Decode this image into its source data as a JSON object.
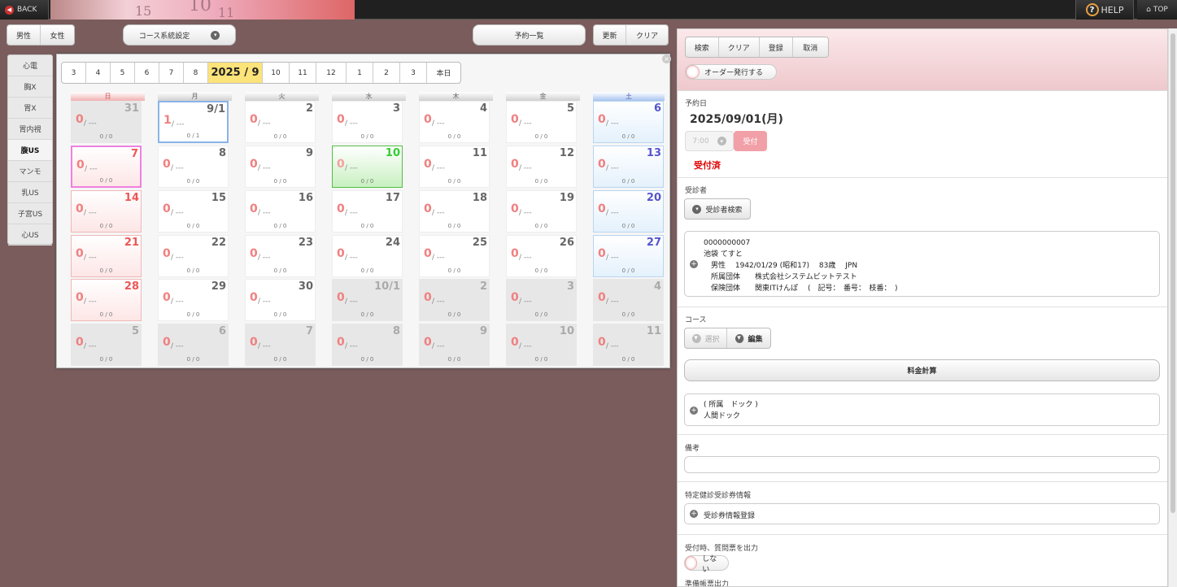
{
  "topbar": {
    "back_label": "BACK",
    "help_label": "HELP",
    "top_label": "TOP",
    "banner_numbers": [
      "15",
      "10",
      "11"
    ]
  },
  "toolbar": {
    "gender": [
      "男性",
      "女性"
    ],
    "course_system": "コース系統設定",
    "reservation_list": "予約一覧",
    "update": "更新",
    "clear": "クリア"
  },
  "sidebar": {
    "items": [
      "心電",
      "胸X",
      "胃X",
      "胃内視",
      "腹US",
      "マンモ",
      "乳US",
      "子宮US",
      "心US"
    ],
    "active_index": 4
  },
  "calendar": {
    "months": [
      "3",
      "4",
      "5",
      "6",
      "7",
      "8"
    ],
    "current": "2025 / 9",
    "months_after": [
      "10",
      "11",
      "12",
      "1",
      "2",
      "3"
    ],
    "today_btn": "本日",
    "close": "×",
    "weekdays": [
      "日",
      "月",
      "火",
      "水",
      "木",
      "金",
      "土"
    ],
    "zero": "0",
    "dash": "/ ---",
    "weeks": [
      [
        {
          "d": "31",
          "t": "prev",
          "c": "0 / 0",
          "n": "0"
        },
        {
          "d": "9/1",
          "t": "sel",
          "c": "0 / 1",
          "n": "1"
        },
        {
          "d": "2",
          "t": "",
          "c": "0 / 0",
          "n": "0"
        },
        {
          "d": "3",
          "t": "",
          "c": "0 / 0",
          "n": "0"
        },
        {
          "d": "4",
          "t": "",
          "c": "0 / 0",
          "n": "0"
        },
        {
          "d": "5",
          "t": "",
          "c": "0 / 0",
          "n": "0"
        },
        {
          "d": "6",
          "t": "sat",
          "c": "0 / 0",
          "n": "0"
        }
      ],
      [
        {
          "d": "7",
          "t": "sun hl",
          "c": "0 / 0",
          "n": "0"
        },
        {
          "d": "8",
          "t": "",
          "c": "0 / 0",
          "n": "0"
        },
        {
          "d": "9",
          "t": "",
          "c": "0 / 0",
          "n": "0"
        },
        {
          "d": "10",
          "t": "today",
          "c": "0 / 0",
          "n": "0"
        },
        {
          "d": "11",
          "t": "",
          "c": "0 / 0",
          "n": "0"
        },
        {
          "d": "12",
          "t": "",
          "c": "0 / 0",
          "n": "0"
        },
        {
          "d": "13",
          "t": "sat",
          "c": "0 / 0",
          "n": "0"
        }
      ],
      [
        {
          "d": "14",
          "t": "sun",
          "c": "0 / 0",
          "n": "0"
        },
        {
          "d": "15",
          "t": "",
          "c": "0 / 0",
          "n": "0"
        },
        {
          "d": "16",
          "t": "",
          "c": "0 / 0",
          "n": "0"
        },
        {
          "d": "17",
          "t": "",
          "c": "0 / 0",
          "n": "0"
        },
        {
          "d": "18",
          "t": "",
          "c": "0 / 0",
          "n": "0"
        },
        {
          "d": "19",
          "t": "",
          "c": "0 / 0",
          "n": "0"
        },
        {
          "d": "20",
          "t": "sat",
          "c": "0 / 0",
          "n": "0"
        }
      ],
      [
        {
          "d": "21",
          "t": "sun",
          "c": "0 / 0",
          "n": "0"
        },
        {
          "d": "22",
          "t": "",
          "c": "0 / 0",
          "n": "0"
        },
        {
          "d": "23",
          "t": "",
          "c": "0 / 0",
          "n": "0"
        },
        {
          "d": "24",
          "t": "",
          "c": "0 / 0",
          "n": "0"
        },
        {
          "d": "25",
          "t": "",
          "c": "0 / 0",
          "n": "0"
        },
        {
          "d": "26",
          "t": "",
          "c": "0 / 0",
          "n": "0"
        },
        {
          "d": "27",
          "t": "sat",
          "c": "0 / 0",
          "n": "0"
        }
      ],
      [
        {
          "d": "28",
          "t": "sun",
          "c": "0 / 0",
          "n": "0"
        },
        {
          "d": "29",
          "t": "",
          "c": "0 / 0",
          "n": "0"
        },
        {
          "d": "30",
          "t": "",
          "c": "0 / 0",
          "n": "0"
        },
        {
          "d": "10/1",
          "t": "prev",
          "c": "0 / 0",
          "n": "0"
        },
        {
          "d": "2",
          "t": "prev",
          "c": "0 / 0",
          "n": "0"
        },
        {
          "d": "3",
          "t": "prev",
          "c": "0 / 0",
          "n": "0"
        },
        {
          "d": "4",
          "t": "prev",
          "c": "0 / 0",
          "n": "0"
        }
      ],
      [
        {
          "d": "5",
          "t": "prev",
          "c": "0 / 0",
          "n": "0"
        },
        {
          "d": "6",
          "t": "prev",
          "c": "0 / 0",
          "n": "0"
        },
        {
          "d": "7",
          "t": "prev",
          "c": "0 / 0",
          "n": "0"
        },
        {
          "d": "8",
          "t": "prev",
          "c": "0 / 0",
          "n": "0"
        },
        {
          "d": "9",
          "t": "prev",
          "c": "0 / 0",
          "n": "0"
        },
        {
          "d": "10",
          "t": "prev",
          "c": "0 / 0",
          "n": "0"
        },
        {
          "d": "11",
          "t": "prev",
          "c": "0 / 0",
          "n": "0"
        }
      ]
    ]
  },
  "panel": {
    "actions": [
      "検索",
      "クリア",
      "登録",
      "取消"
    ],
    "order_toggle": "オーダー発行する",
    "reserve_date_label": "予約日",
    "reserve_date": "2025/09/01(月)",
    "time_value": "7:00",
    "accept_btn": "受付",
    "status": "受付済",
    "examinee_label": "受診者",
    "examinee_search": "受診者検索",
    "examinee": {
      "id": "0000000007",
      "name": "池袋 てすと",
      "line1": "男性　 1942/01/29 (昭和17)　 83歳　 JPN",
      "line2": "所属団体　　株式会社システムビットテスト",
      "line3": "保険団体　　関東ITけんぽ　 (　記号：　番号：　枝番：　)"
    },
    "course_label": "コース",
    "course_select": "選択",
    "course_edit": "編集",
    "fee_calc": "料金計算",
    "course_info_1": "( 所属　ドック )",
    "course_info_2": "人間ドック",
    "remarks_label": "備考",
    "remarks_value": "",
    "voucher_label": "特定健診受診券情報",
    "voucher_register": "受診券情報登録",
    "questionnaire_label": "受付時、質問票を出力",
    "questionnaire_toggle": "しない",
    "prep_label": "準備帳票出力"
  },
  "colors": {
    "background": "#7a5c5c",
    "status_red": "#e00000",
    "today_green": "#33cc33",
    "current_month": "#fce37a"
  }
}
